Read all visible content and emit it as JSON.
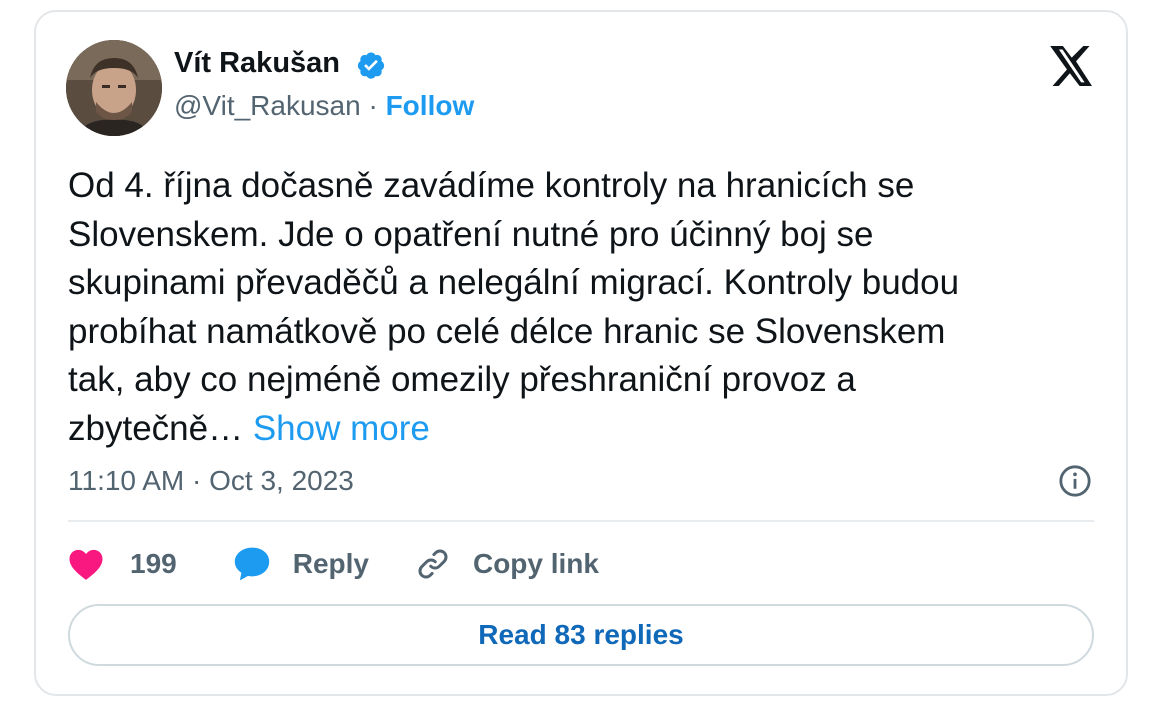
{
  "author": {
    "name": "Vít Rakušan",
    "handle": "@Vit_Rakusan",
    "separator": " · ",
    "follow_label": "Follow",
    "verified": true
  },
  "tweet": {
    "text": "Od 4. října dočasně zavádíme kontroly na hranicích se\nSlovenskem. Jde o opatření nutné pro účinný boj se\nskupinami převaděčů a nelegální migrací. Kontroly budou\nprobíhat namátkově po celé délce hranic se Slovenskem\ntak, aby co nejméně omezily přeshraniční provoz a\nzbytečně… ",
    "show_more_label": "Show more",
    "timestamp": "11:10 AM · Oct 3, 2023"
  },
  "actions": {
    "likes_count": "199",
    "reply_label": "Reply",
    "copy_link_label": "Copy link"
  },
  "read_replies_label": "Read 83 replies",
  "colors": {
    "accent": "#1d9bf0",
    "heart": "#f91880",
    "text": "#0f1419",
    "secondary": "#536471"
  },
  "icons": {
    "verified": "verified-badge-icon",
    "logo": "x-logo-icon",
    "info": "info-icon",
    "like": "heart-icon",
    "reply": "speech-bubble-icon",
    "copy": "link-icon"
  }
}
